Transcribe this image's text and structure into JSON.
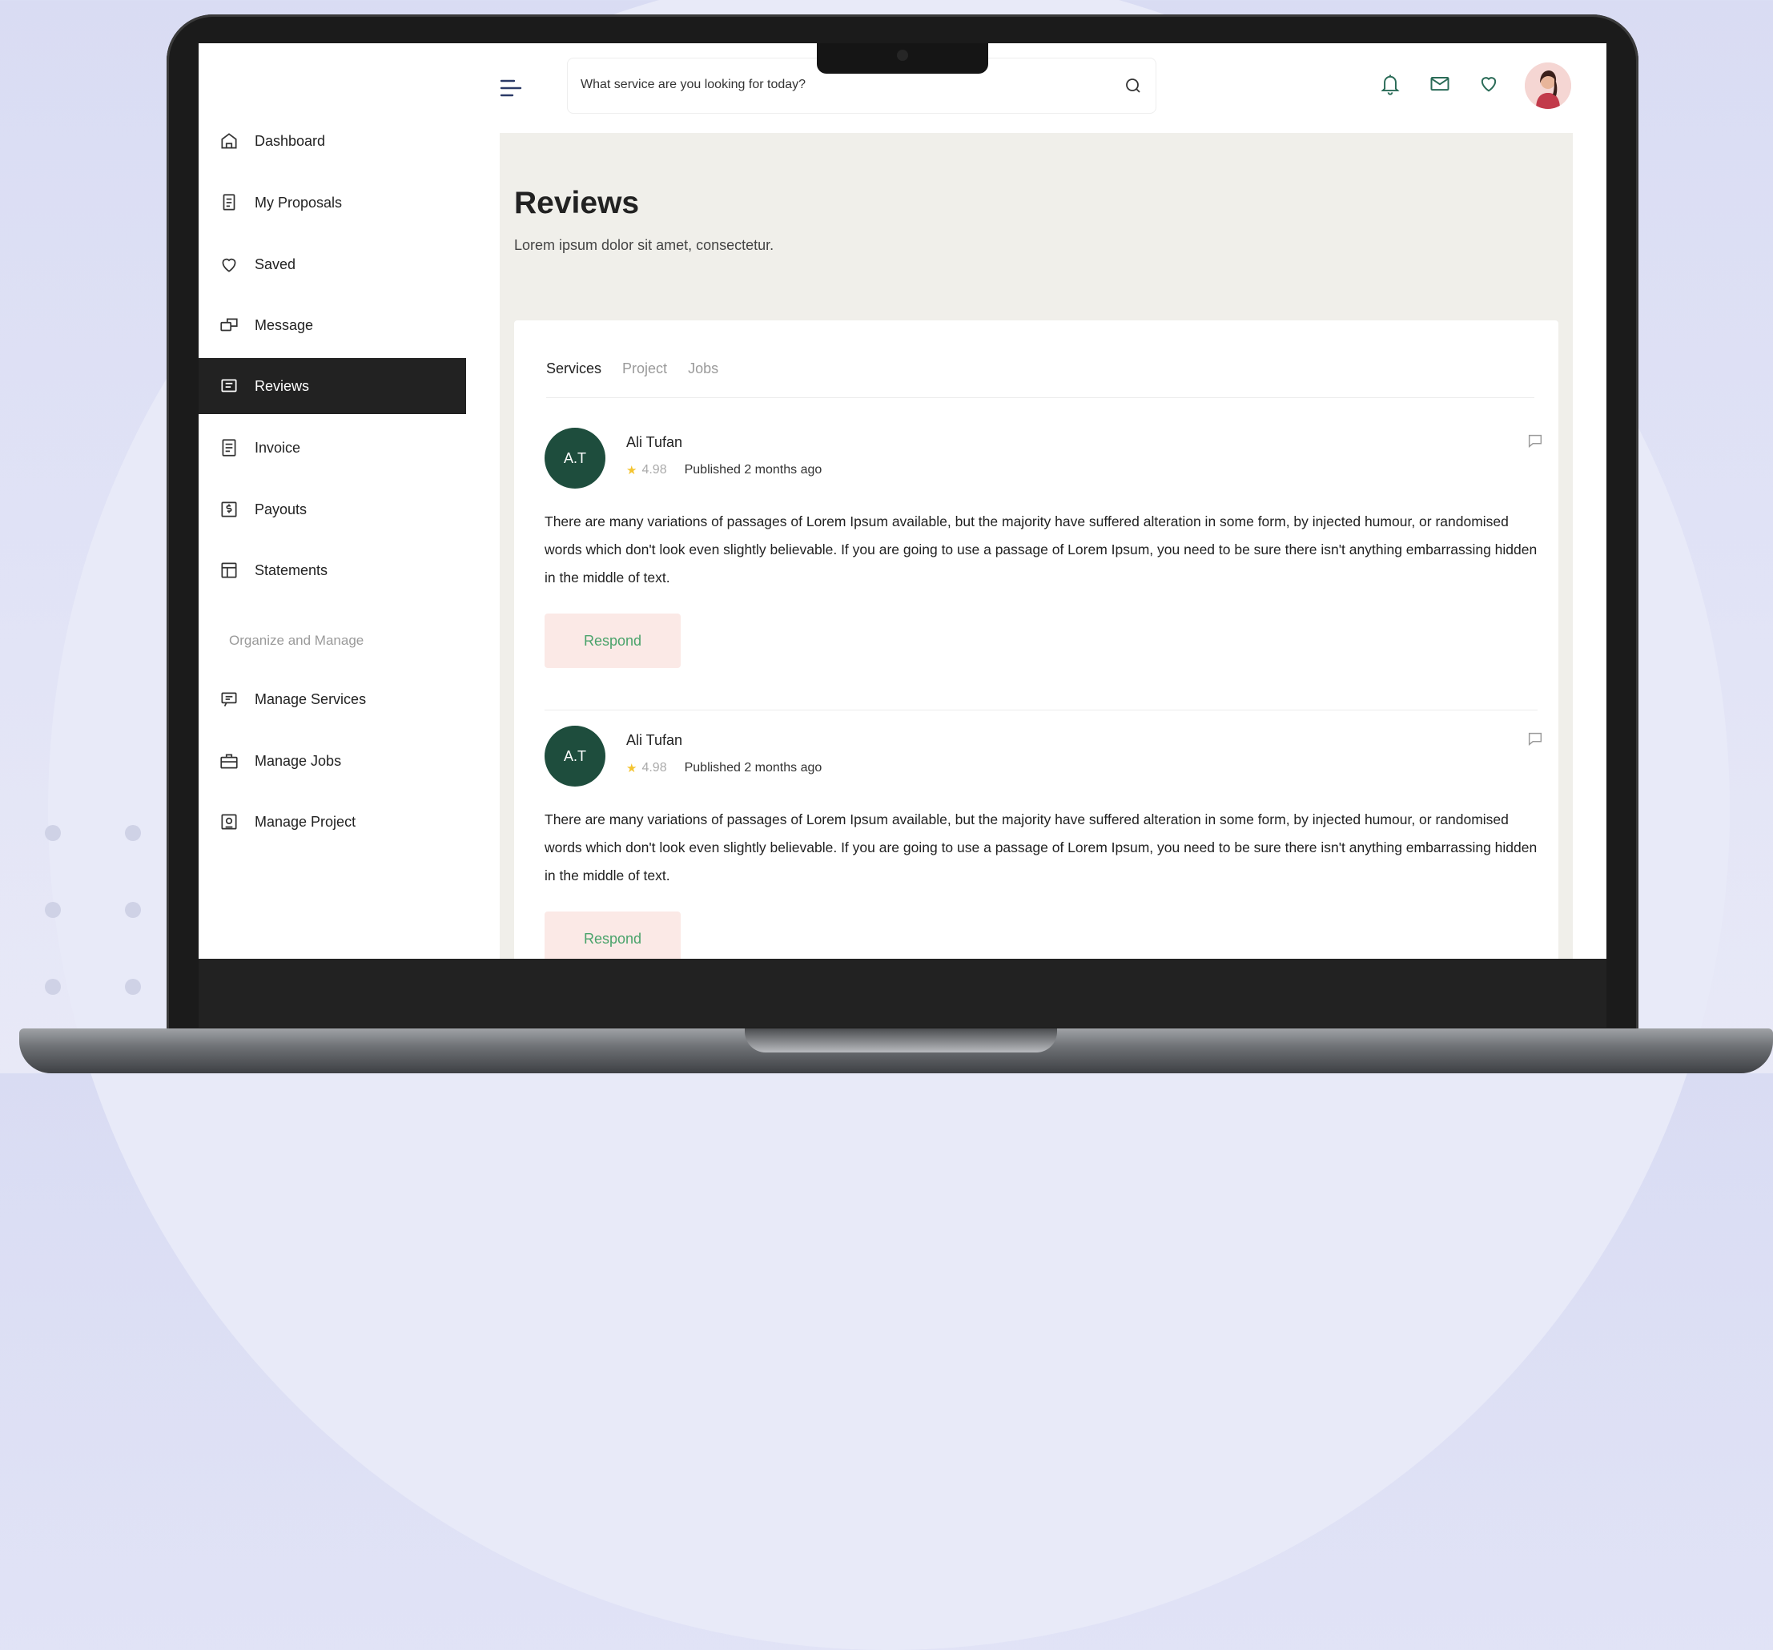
{
  "search": {
    "placeholder": "What service are you looking for today?"
  },
  "sidebar": {
    "items": [
      {
        "label": "Dashboard",
        "icon": "home-icon"
      },
      {
        "label": "My Proposals",
        "icon": "proposals-icon"
      },
      {
        "label": "Saved",
        "icon": "heart-icon"
      },
      {
        "label": "Message",
        "icon": "message-icon"
      },
      {
        "label": "Reviews",
        "icon": "reviews-icon",
        "active": true
      },
      {
        "label": "Invoice",
        "icon": "invoice-icon"
      },
      {
        "label": "Payouts",
        "icon": "payouts-icon"
      },
      {
        "label": "Statements",
        "icon": "statements-icon"
      }
    ],
    "section_label": "Organize and Manage",
    "manage_items": [
      {
        "label": "Manage Services",
        "icon": "manage-services-icon"
      },
      {
        "label": "Manage Jobs",
        "icon": "briefcase-icon"
      },
      {
        "label": "Manage Project",
        "icon": "project-icon"
      }
    ]
  },
  "header": {
    "icons": [
      "menu-icon",
      "search-icon",
      "bell-icon",
      "mail-icon",
      "heart-icon",
      "avatar"
    ]
  },
  "main": {
    "title": "Reviews",
    "subtitle": "Lorem ipsum dolor sit amet, consectetur.",
    "tabs": [
      {
        "label": "Services",
        "active": true
      },
      {
        "label": "Project"
      },
      {
        "label": "Jobs"
      }
    ],
    "reviews": [
      {
        "initials": "A.T",
        "name": "Ali Tufan",
        "rating": "4.98",
        "published": "Published 2 months ago",
        "text": "There are many variations of passages of Lorem Ipsum available, but the majority have suffered alteration in some form, by injected humour, or randomised words which don't look even slightly believable. If you are going to use a passage of Lorem Ipsum, you need to be sure there isn't anything embarrassing hidden in the middle of text.",
        "respond_label": "Respond"
      },
      {
        "initials": "A.T",
        "name": "Ali Tufan",
        "rating": "4.98",
        "published": "Published 2 months ago",
        "text": "There are many variations of passages of Lorem Ipsum available, but the majority have suffered alteration in some form, by injected humour, or randomised words which don't look even slightly believable. If you are going to use a passage of Lorem Ipsum, you need to be sure there isn't anything embarrassing hidden in the middle of text.",
        "respond_label": "Respond"
      }
    ]
  },
  "colors": {
    "active_nav_bg": "#222222",
    "avatar_bg": "#1e4d3d",
    "respond_bg": "#fbe9e6",
    "respond_text": "#4aa36b",
    "star": "#f4c430",
    "main_bg": "#f0efea"
  }
}
